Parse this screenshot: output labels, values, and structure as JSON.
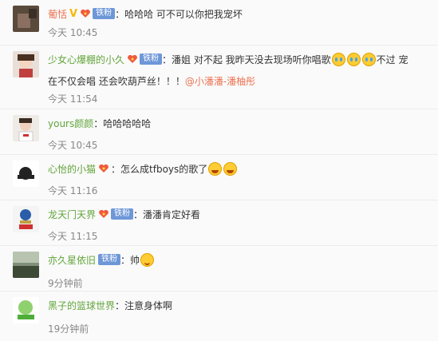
{
  "comments": [
    {
      "user": "葡恬",
      "has_v": true,
      "v_label": "V",
      "fan_label": "铁粉",
      "text": "：哈哈哈 可不可以你把我宠坏",
      "time": "今天 10:45"
    },
    {
      "user": "少女心爆棚的小久",
      "has_v": false,
      "fan_label": "铁粉",
      "text_a": "：潘姐 对不起 我昨天没去现场听你唱歌",
      "text_b": "不过 宠",
      "text_line2": "在不仅会唱 还会吹葫芦丝！！！",
      "mention": "@小潘潘-潘柚彤",
      "time": "今天 11:54"
    },
    {
      "user": "yours颜颜",
      "text": "：哈哈哈哈哈",
      "time": "今天 10:45"
    },
    {
      "user": "心怡的小猫",
      "fan_label": "",
      "text": "：怎么成tfboys的歌了",
      "time": "今天 11:16"
    },
    {
      "user": "龙天门天界",
      "fan_label": "铁粉",
      "text": "：潘潘肯定好看",
      "time": "今天 11:15"
    },
    {
      "user": "亦久星依旧",
      "fan_label": "铁粉",
      "text": "：帅",
      "time": "9分钟前"
    },
    {
      "user": "黑子的篮球世界",
      "text": "：注意身体啊",
      "time": "19分钟前"
    }
  ],
  "icons": {
    "emoji_cry": "cry-emoji-icon",
    "emoji_laugh": "laugh-cry-emoji-icon",
    "emoji_smile": "smile-emoji-icon",
    "heart": "fan-heart-icon"
  },
  "colors": {
    "username": "#eb7350",
    "username_green": "#62a53b",
    "fan_badge": "#6e97d8",
    "v_badge": "#f5b90a",
    "time": "#888888"
  }
}
